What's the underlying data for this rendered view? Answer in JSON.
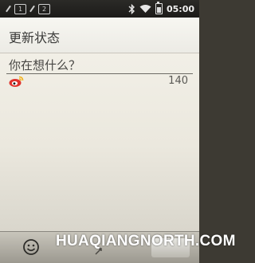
{
  "status_bar": {
    "sim1_label": "1",
    "sim2_label": "2",
    "time": "05:00",
    "icons": [
      "bluetooth-icon",
      "wifi-icon",
      "battery-icon"
    ]
  },
  "compose": {
    "title": "更新状态",
    "placeholder": "你在想什么？",
    "char_count": "140",
    "service_icon": "weibo-icon"
  },
  "toolbar": {
    "icons": [
      "smiley-icon",
      "attach-icon"
    ]
  },
  "watermark": "HUAQIANGNORTH.COM",
  "colors": {
    "background": "#efece4",
    "weibo_red": "#e0332d",
    "weibo_yellow": "#f3b21c"
  }
}
